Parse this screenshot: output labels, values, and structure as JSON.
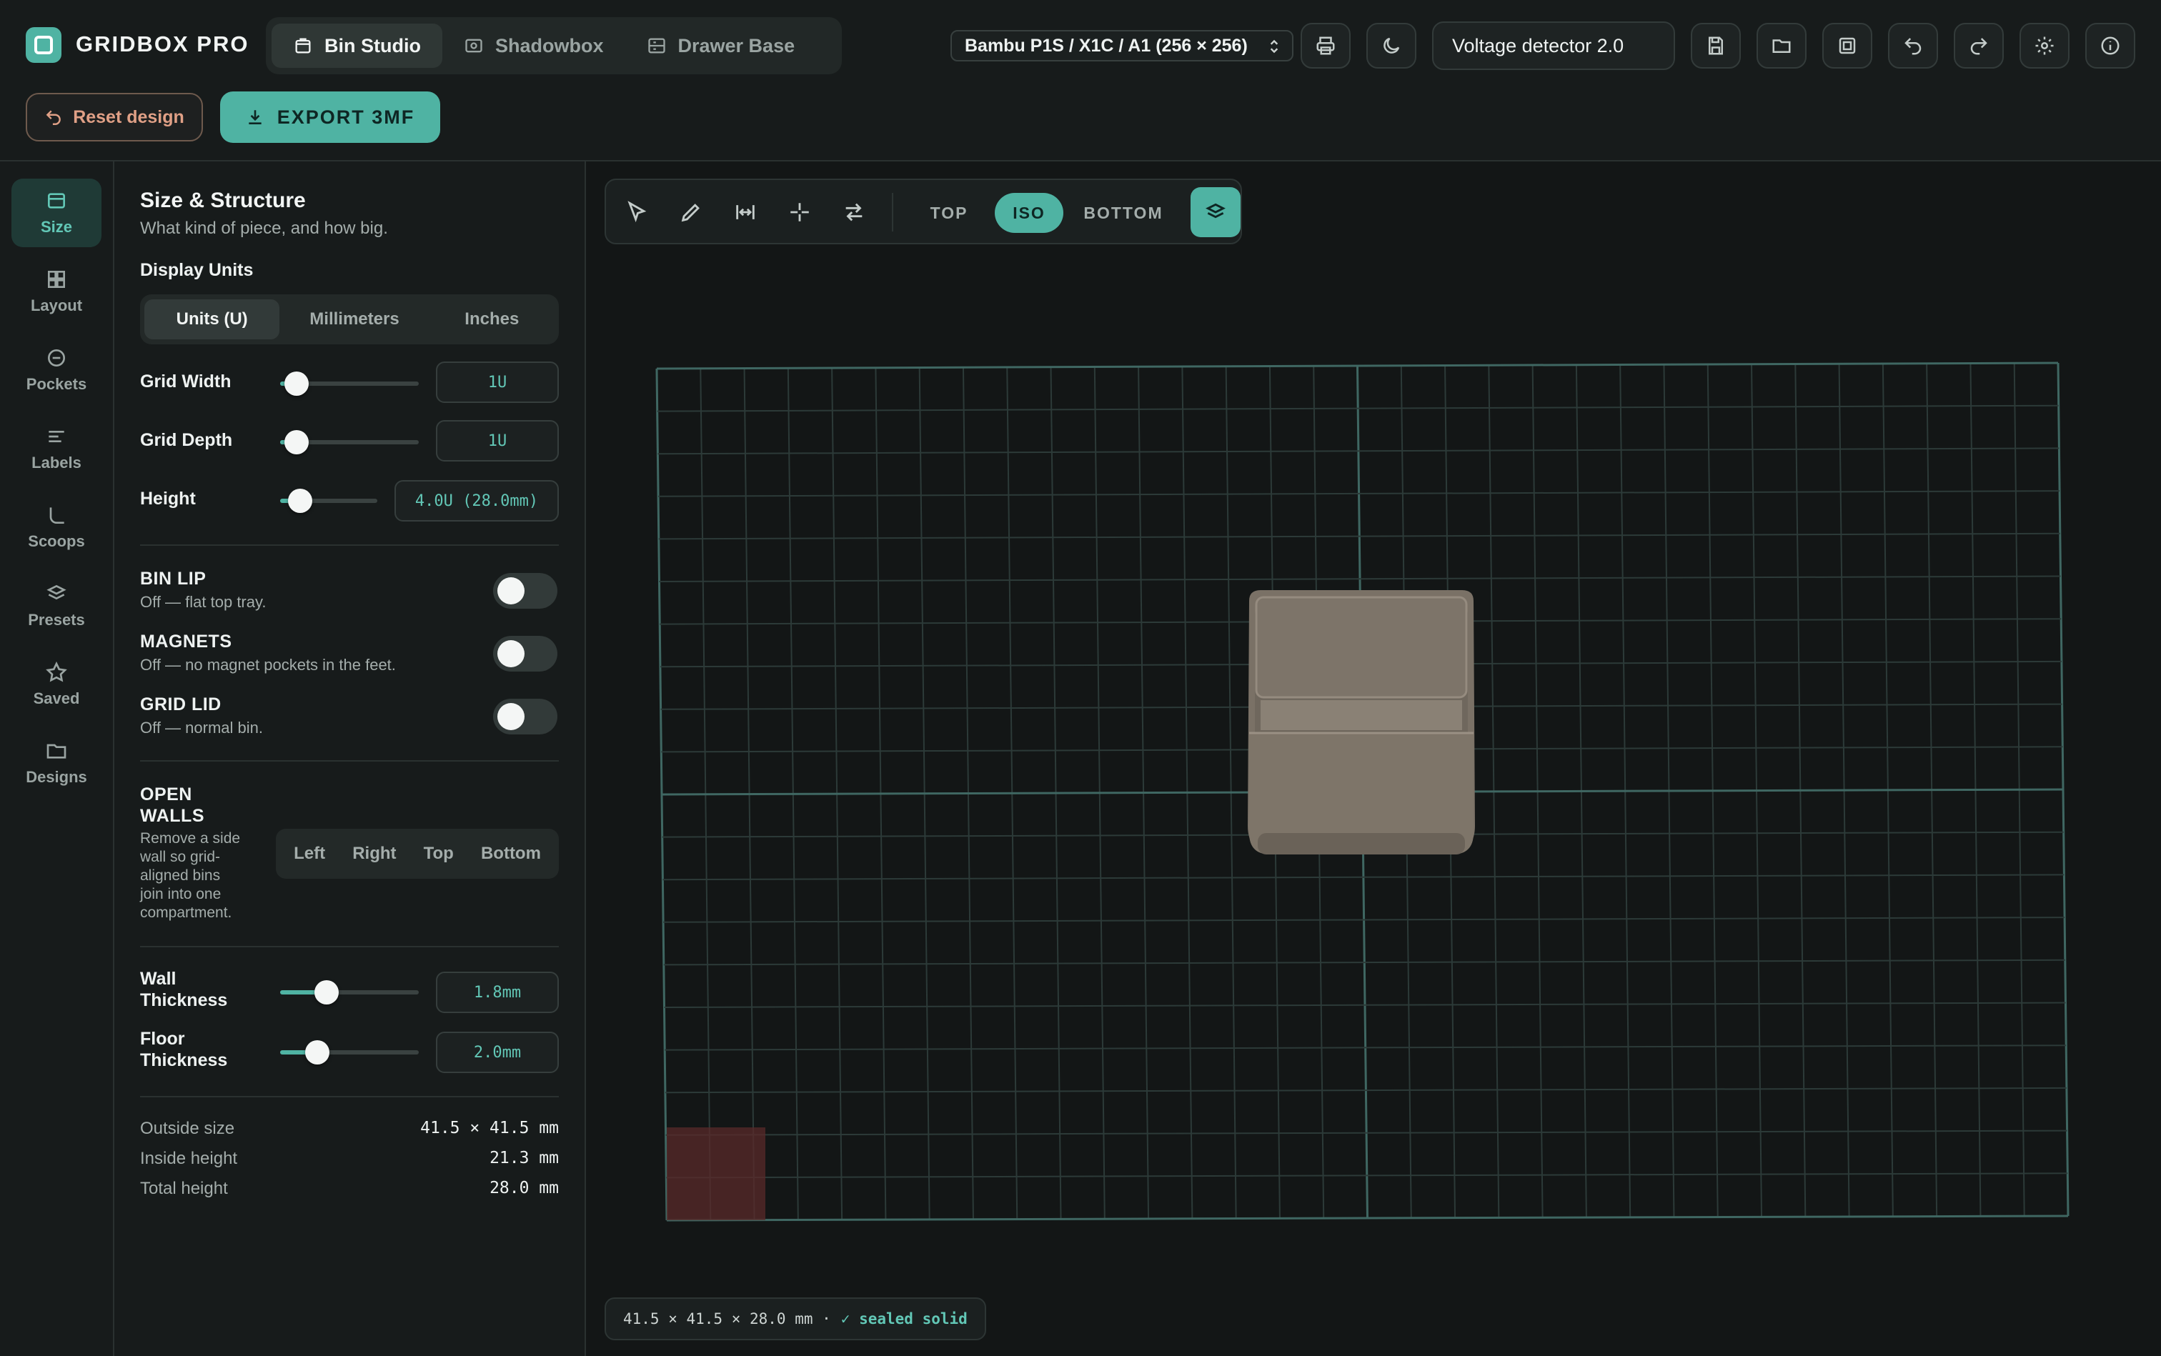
{
  "brand": {
    "name": "GRIDBOX PRO"
  },
  "mode_tabs": [
    {
      "label": "Bin Studio",
      "icon": "bin-icon",
      "active": true
    },
    {
      "label": "Shadowbox",
      "icon": "shadowbox-icon",
      "active": false
    },
    {
      "label": "Drawer Base",
      "icon": "drawer-icon",
      "active": false
    }
  ],
  "printer": {
    "selected": "Bambu P1S / X1C / A1 (256 × 256)"
  },
  "project": {
    "name": "Voltage detector 2.0"
  },
  "toolbar_icons": [
    "printer-icon",
    "moon-icon",
    "save-icon",
    "folder-icon",
    "library-icon",
    "undo-icon",
    "redo-icon",
    "settings-icon",
    "info-icon"
  ],
  "actions": {
    "reset_label": "Reset design",
    "export_label": "EXPORT 3MF"
  },
  "rail": {
    "items": [
      {
        "label": "Size",
        "icon": "size-icon",
        "active": true
      },
      {
        "label": "Layout",
        "icon": "grid-icon",
        "active": false
      },
      {
        "label": "Pockets",
        "icon": "pocket-icon",
        "active": false
      },
      {
        "label": "Labels",
        "icon": "label-lines-icon",
        "active": false
      },
      {
        "label": "Scoops",
        "icon": "scoop-icon",
        "active": false
      },
      {
        "label": "Presets",
        "icon": "layers-icon",
        "active": false
      },
      {
        "label": "Saved",
        "icon": "star-icon",
        "active": false
      },
      {
        "label": "Designs",
        "icon": "folder-icon",
        "active": false
      }
    ]
  },
  "panel": {
    "title": "Size & Structure",
    "subtitle": "What kind of piece, and how big.",
    "display_units": {
      "label": "Display Units",
      "options": [
        "Units (U)",
        "Millimeters",
        "Inches"
      ],
      "selected": "Units (U)"
    },
    "grid_width": {
      "label": "Grid Width",
      "value": "1U",
      "level": 0
    },
    "grid_depth": {
      "label": "Grid Depth",
      "value": "1U",
      "level": 0
    },
    "height": {
      "label": "Height",
      "value": "4.0U (28.0mm)",
      "level": 0.05
    },
    "bin_lip": {
      "title": "BIN LIP",
      "desc": "Off — flat top tray.",
      "on": false
    },
    "magnets": {
      "title": "MAGNETS",
      "desc": "Off — no magnet pockets in the feet.",
      "on": false
    },
    "grid_lid": {
      "title": "GRID LID",
      "desc": "Off — normal bin.",
      "on": false
    },
    "open_walls": {
      "title_line1": "OPEN",
      "title_line2": "WALLS",
      "desc_lines": [
        "Remove a side",
        "wall so grid-",
        "aligned bins",
        "join into one",
        "compartment."
      ],
      "options": [
        "Left",
        "Right",
        "Top",
        "Bottom"
      ]
    },
    "wall_thickness": {
      "label_line1": "Wall",
      "label_line2": "Thickness",
      "value": "1.8mm",
      "level": 0.27
    },
    "floor_thickness": {
      "label_line1": "Floor",
      "label_line2": "Thickness",
      "value": "2.0mm",
      "level": 0.19
    },
    "stats": [
      {
        "label": "Outside size",
        "value": "41.5 × 41.5 mm"
      },
      {
        "label": "Inside height",
        "value": "21.3 mm"
      },
      {
        "label": "Total height",
        "value": "28.0 mm"
      }
    ]
  },
  "viewport": {
    "tools": [
      "select-icon",
      "pencil-icon",
      "measure-icon",
      "crosshair-icon",
      "swap-icon"
    ],
    "views": [
      "TOP",
      "ISO",
      "BOTTOM"
    ],
    "active_view": "ISO",
    "layers_icon": "layers-icon",
    "status": {
      "dimensions": "41.5 × 41.5 × 28.0 mm ·",
      "ok": "✓ sealed solid"
    }
  },
  "colors": {
    "accent": "#4fb3a3",
    "accent_text": "#62c7b6",
    "reset_text": "#e0a086",
    "bin": "#7a7166",
    "origin_marker": "#5a2a2a"
  }
}
